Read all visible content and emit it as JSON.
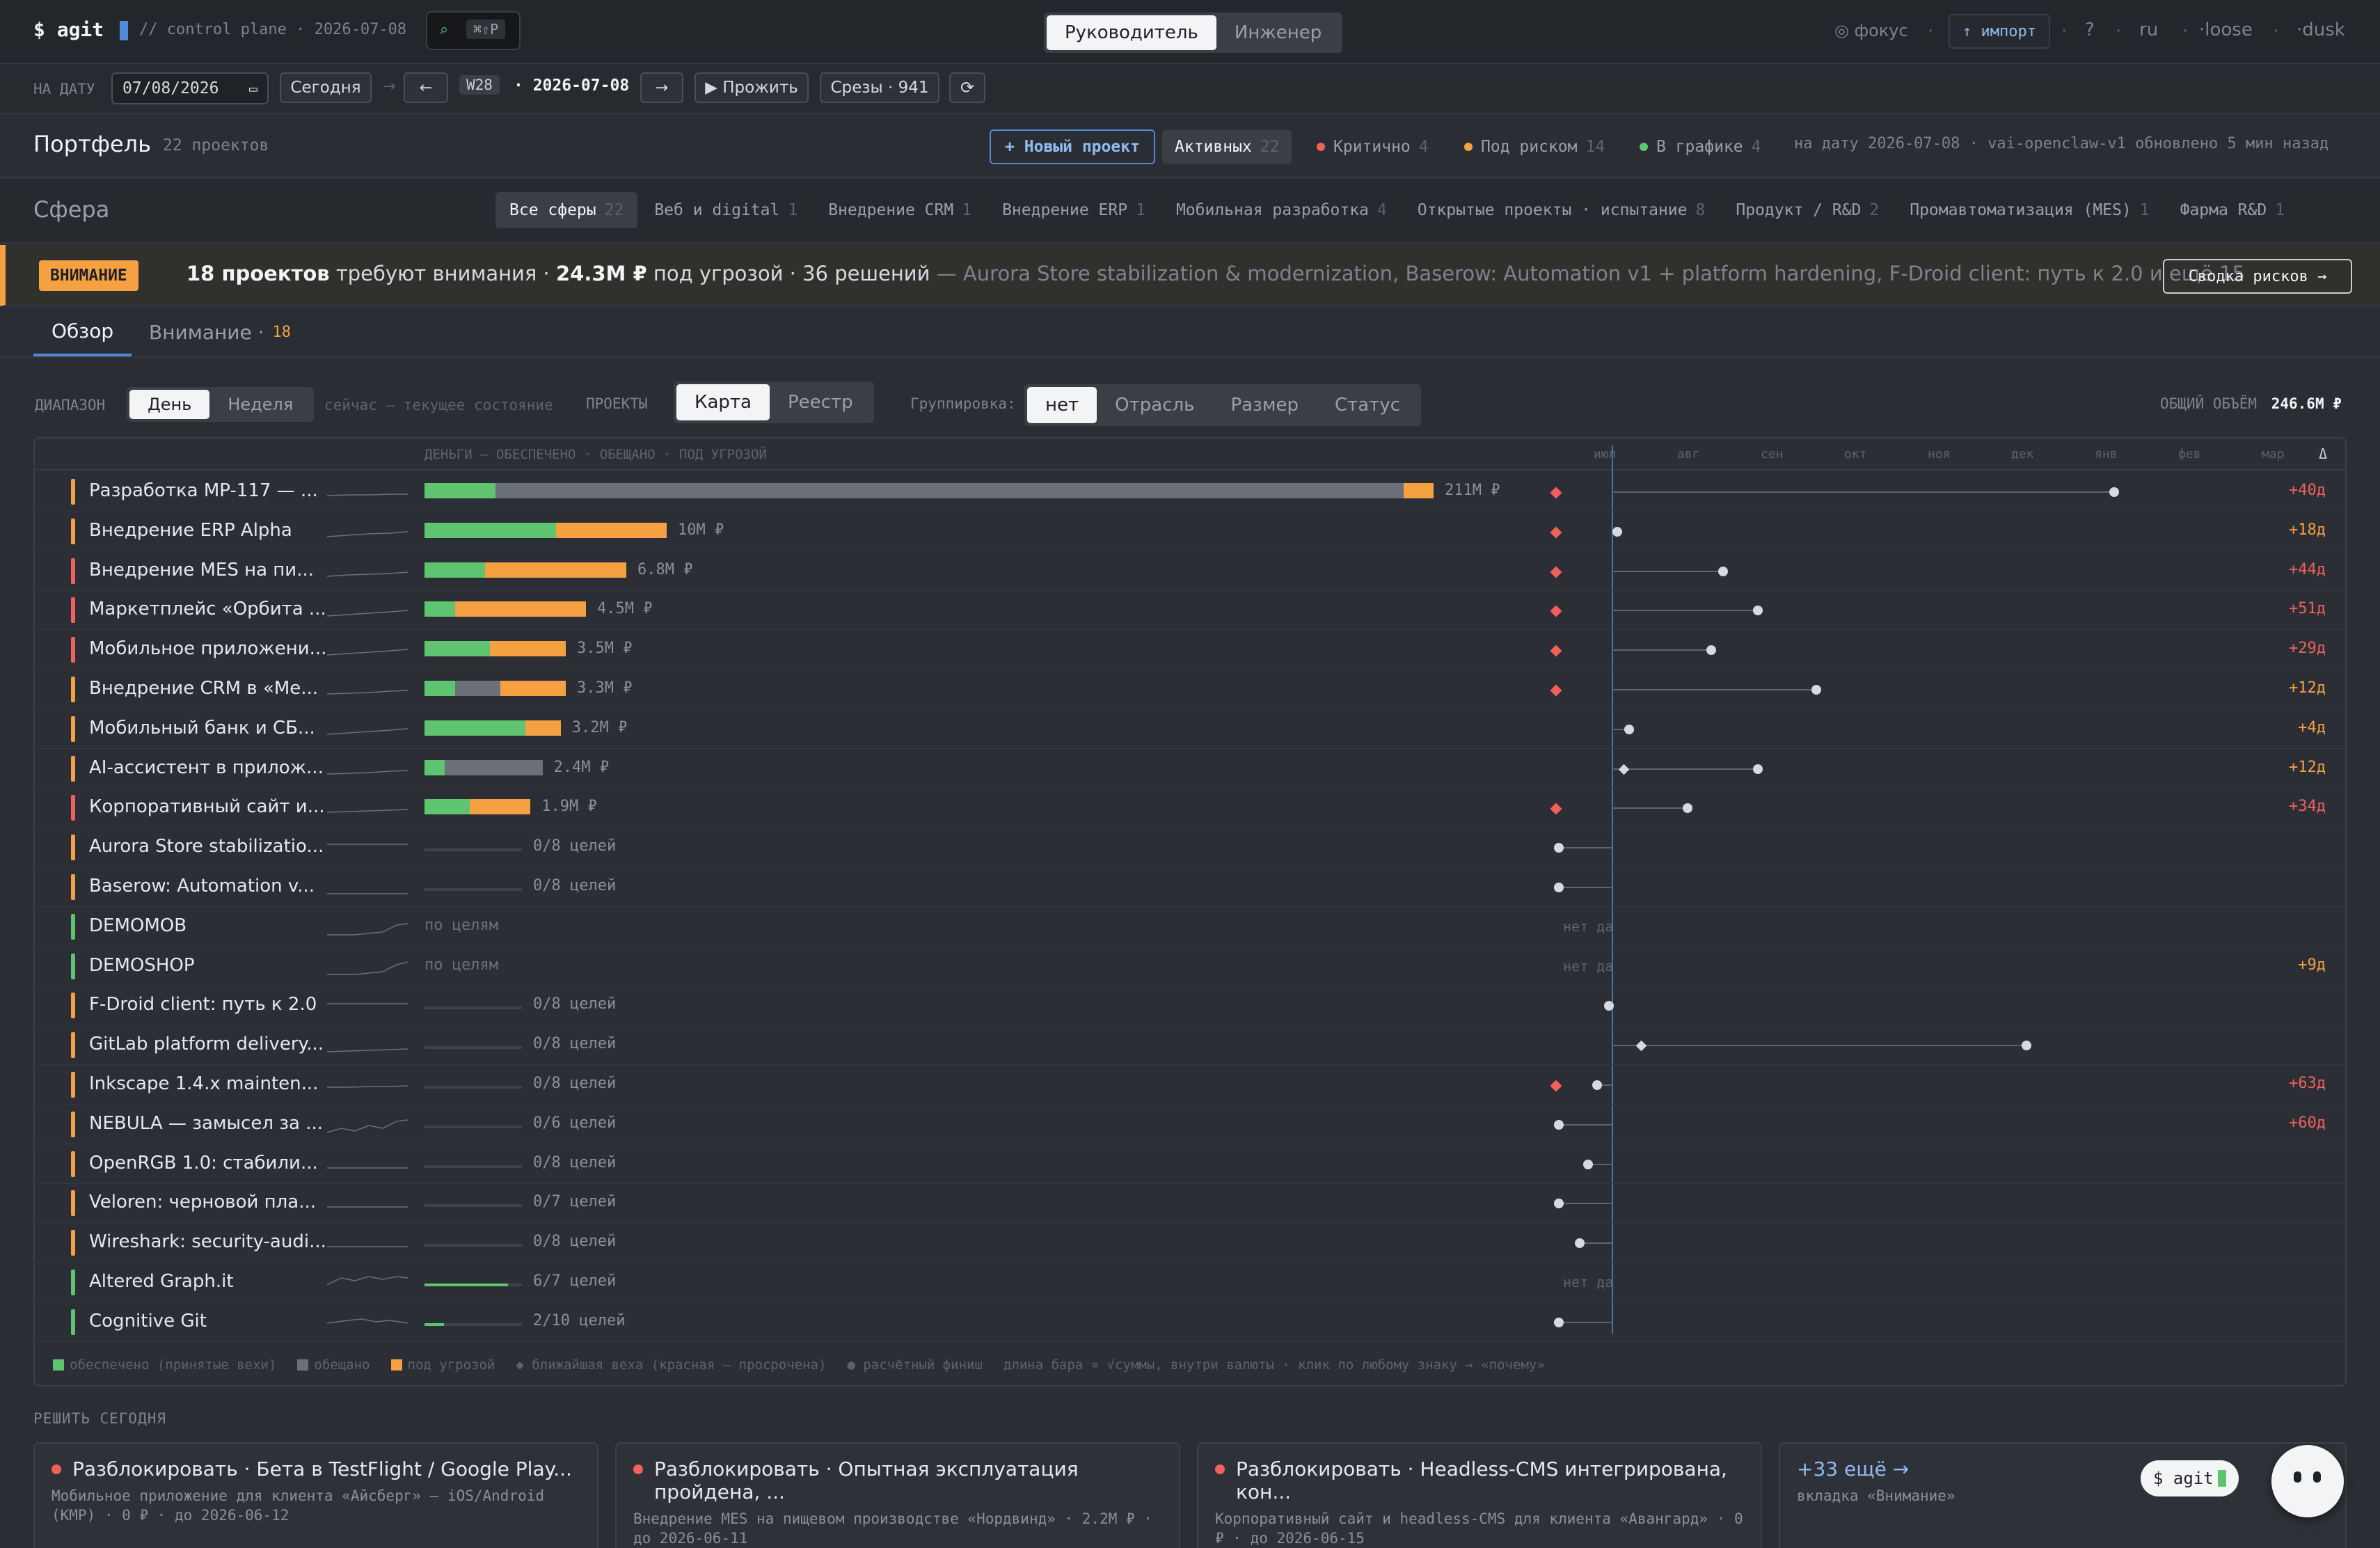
{
  "topbar": {
    "app": "$ agit",
    "subtitle": "// control plane · 2026-07-08",
    "search_hint": "⌘⇧P",
    "roles": [
      "Руководитель",
      "Инженер"
    ],
    "focus": "◎ фокус",
    "import": "↑ импорт",
    "help": "?",
    "lang": "ru",
    "density": "·loose",
    "theme": "·dusk"
  },
  "subbar": {
    "date_label": "НА ДАТУ",
    "date_value": "07/08/2026",
    "today": "Сегодня",
    "arrow": "→",
    "prev": "←",
    "week": "W28",
    "date_text": "· 2026-07-08",
    "next": "→",
    "play": "▶ Прожить",
    "slices": "Срезы · 941",
    "refresh": "⟳"
  },
  "portfolio": {
    "title": "Портфель",
    "count": "22 проектов",
    "new_project": "+ Новый проект",
    "active_label": "Активных",
    "active_count": "22",
    "critical_label": "Критично",
    "critical_count": "4",
    "risk_label": "Под риском",
    "risk_count": "14",
    "ontrack_label": "В графике",
    "ontrack_count": "4",
    "status_line": "на дату 2026-07-08 · vai-openclaw-v1 обновлено 5 мин назад",
    "colors": {
      "critical": "#f0615b",
      "risk": "#f5a142",
      "ontrack": "#5fc46f"
    }
  },
  "sphere": {
    "title": "Сфера",
    "tabs": [
      {
        "label": "Все сферы",
        "count": "22"
      },
      {
        "label": "Веб и digital",
        "count": "1"
      },
      {
        "label": "Внедрение CRM",
        "count": "1"
      },
      {
        "label": "Внедрение ERP",
        "count": "1"
      },
      {
        "label": "Мобильная разработка",
        "count": "4"
      },
      {
        "label": "Открытые проекты · испытание",
        "count": "8"
      },
      {
        "label": "Продукт / R&D",
        "count": "2"
      },
      {
        "label": "Промавтоматизация (MES)",
        "count": "1"
      },
      {
        "label": "Фарма R&D",
        "count": "1"
      }
    ]
  },
  "alert": {
    "badge": "ВНИМАНИЕ",
    "projects": "18 проектов",
    "needs": "требуют внимания ·",
    "money": "24.3M ₽",
    "threat": "под угрозой · 36 решений",
    "details": "— Aurora Store stabilization & modernization, Baserow: Automation v1 + platform hardening, F-Droid client: путь к 2.0 и ещё 15",
    "button": "Сводка рисков →"
  },
  "tabs": [
    {
      "label": "Обзор"
    },
    {
      "label": "Внимание ·",
      "count": "18"
    }
  ],
  "controls": {
    "range_label": "ДИАПАЗОН",
    "range": [
      "День",
      "Неделя"
    ],
    "now_text": "сейчас — текущее состояние",
    "projects_label": "ПРОЕКТЫ",
    "views": [
      "Карта",
      "Реестр"
    ],
    "group_label": "Группировка:",
    "groups": [
      "нет",
      "Отрасль",
      "Размер",
      "Статус"
    ],
    "total_label": "ОБЩИЙ ОБЪЁМ",
    "total_value": "246.6M ₽"
  },
  "table": {
    "money_header": "ДЕНЬГИ — ОБЕСПЕЧЕНО · ОБЕЩАНО · ПОД УГРОЗОЙ",
    "months": [
      "июл",
      "авг",
      "сен",
      "окт",
      "ноя",
      "дек",
      "янв",
      "фев",
      "мар"
    ],
    "delta_header": "Δ",
    "rows": [
      {
        "name": "Разработка MP-117 — ...",
        "status": "risk",
        "amount": "211M ₽",
        "secured": 0.07,
        "promised": 0.97,
        "threat": 1.0,
        "overdue": true,
        "delta": "+40д",
        "delta_color": "#f0615b",
        "finish": 0.86,
        "spark": "0,22 30,21 60,21 90,20 116,20"
      },
      {
        "name": "Внедрение ERP Alpha",
        "status": "risk",
        "amount": "10M ₽",
        "secured": 0.13,
        "promised": 0.13,
        "threat": 0.24,
        "overdue": true,
        "delta": "+18д",
        "delta_color": "#f5a142",
        "finish": 0.01,
        "spark": "0,24 30,22 60,20 90,19 116,17"
      },
      {
        "name": "Внедрение MES на пи...",
        "status": "critical",
        "amount": "6.8M ₽",
        "secured": 0.06,
        "promised": 0.06,
        "threat": 0.2,
        "overdue": true,
        "delta": "+44д",
        "delta_color": "#f0615b",
        "finish": 0.19,
        "spark": "0,24 30,22 60,21 90,20 116,18"
      },
      {
        "name": "Маркетплейс «Орбита ...",
        "status": "critical",
        "amount": "4.5M ₽",
        "secured": 0.03,
        "promised": 0.03,
        "threat": 0.16,
        "overdue": true,
        "delta": "+51д",
        "delta_color": "#f0615b",
        "finish": 0.25,
        "spark": "0,25 30,23 60,21 90,19 116,17"
      },
      {
        "name": "Мобильное приложени...",
        "status": "critical",
        "amount": "3.5M ₽",
        "secured": 0.065,
        "promised": 0.065,
        "threat": 0.14,
        "overdue": true,
        "delta": "+29д",
        "delta_color": "#f0615b",
        "finish": 0.17,
        "spark": "0,24 30,22 60,20 90,18 116,16"
      },
      {
        "name": "Внедрение CRM в «Ме...",
        "status": "risk",
        "amount": "3.3M ₽",
        "secured": 0.03,
        "promised": 0.075,
        "threat": 0.14,
        "overdue": true,
        "delta": "+12д",
        "delta_color": "#f5a142",
        "finish": 0.35,
        "spark": "0,23 30,22 60,21 90,19 116,18"
      },
      {
        "name": "Мобильный банк и СБ...",
        "status": "risk",
        "amount": "3.2M ₽",
        "secured": 0.1,
        "promised": 0.1,
        "threat": 0.135,
        "overdue": false,
        "delta": "+4д",
        "delta_color": "#f5a142",
        "finish": 0.03,
        "spark": "0,24 30,22 60,20 90,18 116,16"
      },
      {
        "name": "AI-ассистент в прилож...",
        "status": "risk",
        "amount": "2.4M ₽",
        "secured": 0.02,
        "promised": 0.117,
        "threat": 0.117,
        "overdue": false,
        "delta": "+12д",
        "delta_color": "#f5a142",
        "finish": 0.25,
        "milestone": 0.02,
        "spark": "0,24 30,23 60,22 90,20 116,19"
      },
      {
        "name": "Корпоративный сайт и...",
        "status": "critical",
        "amount": "1.9M ₽",
        "secured": 0.045,
        "promised": 0.045,
        "threat": 0.105,
        "overdue": true,
        "delta": "+34д",
        "delta_color": "#f0615b",
        "finish": 0.13,
        "spark": "0,23 30,22 60,21 90,20 116,19"
      },
      {
        "name": "Aurora Store stabilizatio...",
        "status": "risk",
        "goals": "0/8 целей",
        "finish": -0.09,
        "spark": "0,12 30,12 60,12 90,12 116,12"
      },
      {
        "name": "Baserow: Automation v...",
        "status": "risk",
        "goals": "0/8 целей",
        "finish": -0.09,
        "spark": "0,26 30,26 60,26 90,26 116,26"
      },
      {
        "name": "DEMOMOB",
        "status": "ontrack",
        "goals": "по целям",
        "nodata": "нет да",
        "spark": "0,28 40,28 80,24 100,14 116,12"
      },
      {
        "name": "DEMOSHOP",
        "status": "ontrack",
        "goals": "по целям",
        "nodata": "нет да",
        "delta": "+9д",
        "delta_color": "#f5a142",
        "spark": "0,28 40,28 80,24 100,14 116,10"
      },
      {
        "name": "F-Droid client: путь к 2.0",
        "status": "risk",
        "goals": "0/8 целей",
        "finish": -0.005,
        "spark": "0,14 30,14 60,14 90,14 116,14"
      },
      {
        "name": "GitLab platform delivery...",
        "status": "risk",
        "goals": "0/8 целей",
        "finish": 0.71,
        "milestone": 0.05,
        "spark": "0,26 30,25 60,24 90,23 116,22"
      },
      {
        "name": "Inkscape 1.4.x mainten...",
        "status": "risk",
        "goals": "0/8 целей",
        "finish": -0.025,
        "overdue": true,
        "delta": "+63д",
        "delta_color": "#f0615b",
        "spark": "0,20 30,20 60,19 90,19 116,18"
      },
      {
        "name": "NEBULA — замысел за ...",
        "status": "risk",
        "goals": "0/6 целей",
        "finish": -0.09,
        "delta": "+60д",
        "delta_color": "#f0615b",
        "spark": "0,28 20,22 40,26 60,18 80,22 100,12 116,10"
      },
      {
        "name": "OpenRGB 1.0: стабили...",
        "status": "risk",
        "goals": "0/8 целей",
        "finish": -0.04,
        "spark": "0,22 30,22 60,22 90,22 116,22"
      },
      {
        "name": "Veloren: черновой пла...",
        "status": "risk",
        "goals": "0/7 целей",
        "finish": -0.09,
        "spark": "0,22 30,22 60,22 90,22 116,22"
      },
      {
        "name": "Wireshark: security-audi...",
        "status": "risk",
        "goals": "0/8 целей",
        "finish": -0.055,
        "spark": "0,22 30,22 60,22 90,22 116,22"
      },
      {
        "name": "Altered Graph.it",
        "status": "ontrack",
        "goals": "6/7 целей",
        "progress": 0.857,
        "nodata": "нет да",
        "spark": "0,20 20,10 40,14 60,8 80,12 100,8 116,10"
      },
      {
        "name": "Cognitive Git",
        "status": "ontrack",
        "goals": "2/10 целей",
        "progress": 0.2,
        "finish": -0.09,
        "spark": "0,18 30,14 50,12 70,16 90,14 116,18"
      }
    ]
  },
  "legend": {
    "secured": "обеспечено (принятые вехи)",
    "promised": "обещано",
    "threat": "под угрозой",
    "milestone": "◆ ближайшая веха (красная — просрочена)",
    "finish": "● расчётный финиш",
    "note": "длина бара ∝ √суммы, внутри валюты · клик по любому знаку → «почему»"
  },
  "today": {
    "title": "РЕШИТЬ СЕГОДНЯ",
    "cards": [
      {
        "title": "Разблокировать · Бета в TestFlight / Google Play...",
        "sub": "Мобильное приложение для клиента «Айсберг» — iOS/Android (КМР) · 0 ₽ · до 2026-06-12"
      },
      {
        "title": "Разблокировать · Опытная эксплуатация пройдена, ...",
        "sub": "Внедрение MES на пищевом производстве «Нордвинд» · 2.2M ₽ · до 2026-06-11"
      },
      {
        "title": "Разблокировать · Headless-CMS интегрирована, кон...",
        "sub": "Корпоративный сайт и headless-CMS для клиента «Авангард» · 0 ₽ · до 2026-06-15"
      }
    ],
    "more": "+33 ещё →",
    "more_sub": "вкладка «Внимание»"
  },
  "assistant": {
    "label": "$ agit"
  }
}
